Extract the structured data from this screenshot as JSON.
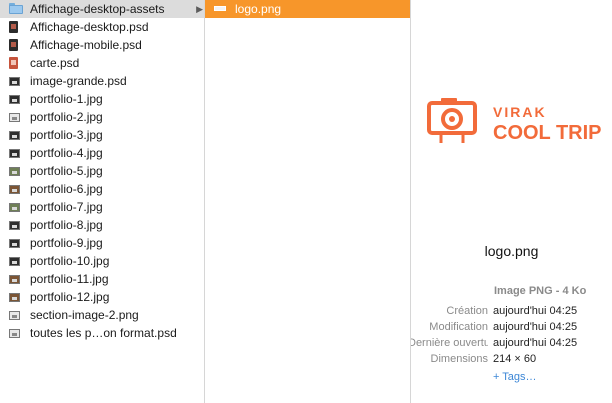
{
  "files": [
    {
      "name": "Affichage-desktop-assets",
      "icon": "folder-icon",
      "state": "selected"
    },
    {
      "name": "Affichage-desktop.psd",
      "icon": "psd-icon"
    },
    {
      "name": "Affichage-mobile.psd",
      "icon": "psd-icon"
    },
    {
      "name": "carte.psd",
      "icon": "psd-red-icon"
    },
    {
      "name": "image-grande.psd",
      "icon": "image-thumbnail-icon"
    },
    {
      "name": "portfolio-1.jpg",
      "icon": "image-thumbnail-icon"
    },
    {
      "name": "portfolio-2.jpg",
      "icon": "image-thumbnail-icon"
    },
    {
      "name": "portfolio-3.jpg",
      "icon": "image-thumbnail-icon"
    },
    {
      "name": "portfolio-4.jpg",
      "icon": "image-thumbnail-icon"
    },
    {
      "name": "portfolio-5.jpg",
      "icon": "image-thumbnail-icon"
    },
    {
      "name": "portfolio-6.jpg",
      "icon": "image-thumbnail-icon"
    },
    {
      "name": "portfolio-7.jpg",
      "icon": "image-thumbnail-icon"
    },
    {
      "name": "portfolio-8.jpg",
      "icon": "image-thumbnail-icon"
    },
    {
      "name": "portfolio-9.jpg",
      "icon": "image-thumbnail-icon"
    },
    {
      "name": "portfolio-10.jpg",
      "icon": "image-thumbnail-icon"
    },
    {
      "name": "portfolio-11.jpg",
      "icon": "image-thumbnail-icon"
    },
    {
      "name": "portfolio-12.jpg",
      "icon": "image-thumbnail-icon"
    },
    {
      "name": "section-image-2.png",
      "icon": "image-thumbnail-icon"
    },
    {
      "name": "toutes les p…on format.psd",
      "icon": "image-thumbnail-icon"
    }
  ],
  "subfolder": {
    "items": [
      {
        "name": "logo.png",
        "icon": "png-icon",
        "state": "selected"
      }
    ]
  },
  "preview": {
    "logo": {
      "line1": "VIRAK",
      "line2": "COOL TRIP",
      "color": "#f26b3a"
    },
    "filename": "logo.png",
    "kind": "Image PNG - 4 Ko",
    "rows": [
      {
        "label": "Création",
        "value": "aujourd'hui 04:25"
      },
      {
        "label": "Modification",
        "value": "aujourd'hui 04:25"
      },
      {
        "label": "Dernière ouverture",
        "value": "aujourd'hui 04:25"
      },
      {
        "label": "Dimensions",
        "value": "214 × 60"
      }
    ],
    "tags_link": "+ Tags…"
  },
  "colors": {
    "selection_active": "#f7962a",
    "selection_inactive": "#dcdcdc",
    "tag_link": "#3d87d6"
  }
}
